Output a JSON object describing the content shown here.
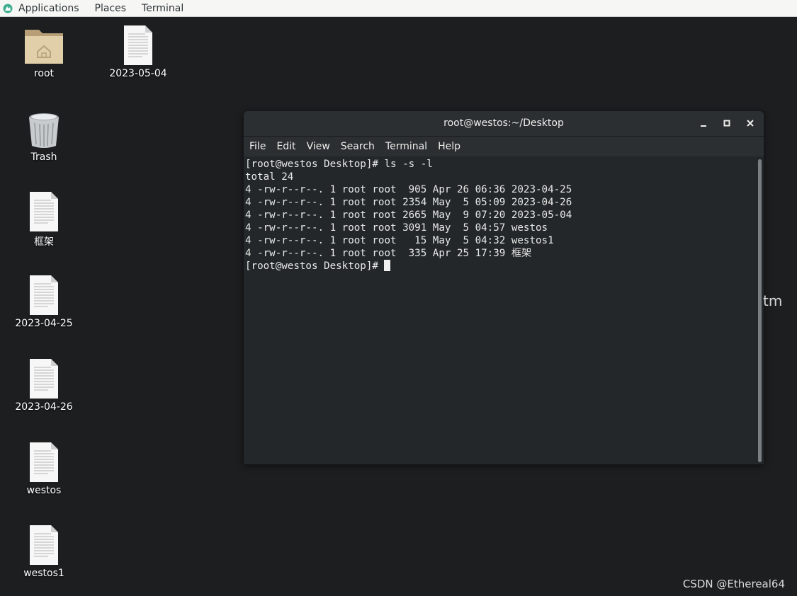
{
  "topbar": {
    "applications": "Applications",
    "places": "Places",
    "terminal": "Terminal"
  },
  "desktop": {
    "icons": [
      {
        "label": "root",
        "icon": "home-folder-icon"
      },
      {
        "label": "2023-05-04",
        "icon": "text-file-icon"
      },
      {
        "label": "Trash",
        "icon": "trash-icon"
      },
      {
        "label": "框架",
        "icon": "text-file-icon"
      },
      {
        "label": "2023-04-25",
        "icon": "text-file-icon"
      },
      {
        "label": "2023-04-26",
        "icon": "text-file-icon"
      },
      {
        "label": "westos",
        "icon": "text-file-icon"
      },
      {
        "label": "westos1",
        "icon": "text-file-icon"
      }
    ],
    "partial_text": "tm"
  },
  "terminal": {
    "title": "root@westos:~/Desktop",
    "menu": [
      "File",
      "Edit",
      "View",
      "Search",
      "Terminal",
      "Help"
    ],
    "lines": [
      "[root@westos Desktop]# ls -s -l",
      "total 24",
      "4 -rw-r--r--. 1 root root  905 Apr 26 06:36 2023-04-25",
      "4 -rw-r--r--. 1 root root 2354 May  5 05:09 2023-04-26",
      "4 -rw-r--r--. 1 root root 2665 May  9 07:20 2023-05-04",
      "4 -rw-r--r--. 1 root root 3091 May  5 04:57 westos",
      "4 -rw-r--r--. 1 root root   15 May  5 04:32 westos1",
      "4 -rw-r--r--. 1 root root  335 Apr 25 17:39 框架"
    ],
    "prompt": "[root@westos Desktop]# "
  },
  "watermark": "CSDN @Ethereal64",
  "colors": {
    "desktop_bg": "#1d1e20",
    "terminal_bg": "#232729",
    "terminal_text": "#e7e9e8",
    "brand_logo": "#3fae8d"
  }
}
